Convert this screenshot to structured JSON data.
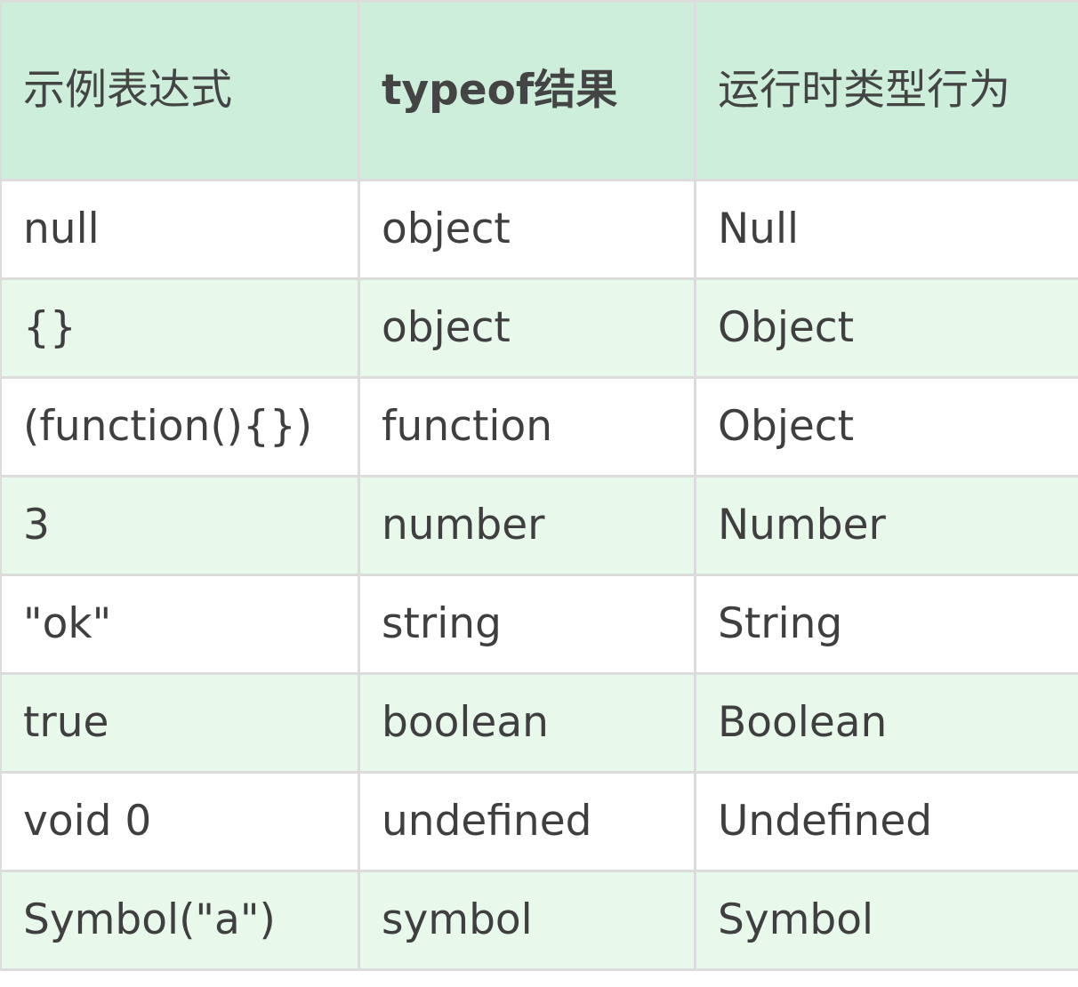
{
  "table": {
    "headers": [
      "示例表达式",
      "typeof结果",
      "运行时类型行为"
    ],
    "rows": [
      [
        "null",
        "object",
        "Null"
      ],
      [
        "{}",
        "object",
        "Object"
      ],
      [
        "(function(){})",
        "function",
        "Object"
      ],
      [
        "3",
        "number",
        "Number"
      ],
      [
        "\"ok\"",
        "string",
        "String"
      ],
      [
        "true",
        "boolean",
        "Boolean"
      ],
      [
        "void 0",
        "undefined",
        "Undefined"
      ],
      [
        "Symbol(\"a\")",
        "symbol",
        "Symbol"
      ]
    ]
  },
  "colors": {
    "header_bg": "#cdeedb",
    "row_alt_bg": "#e8f8ea",
    "row_bg": "#ffffff",
    "border": "#dcdcdc",
    "text": "#3f3f3f"
  }
}
